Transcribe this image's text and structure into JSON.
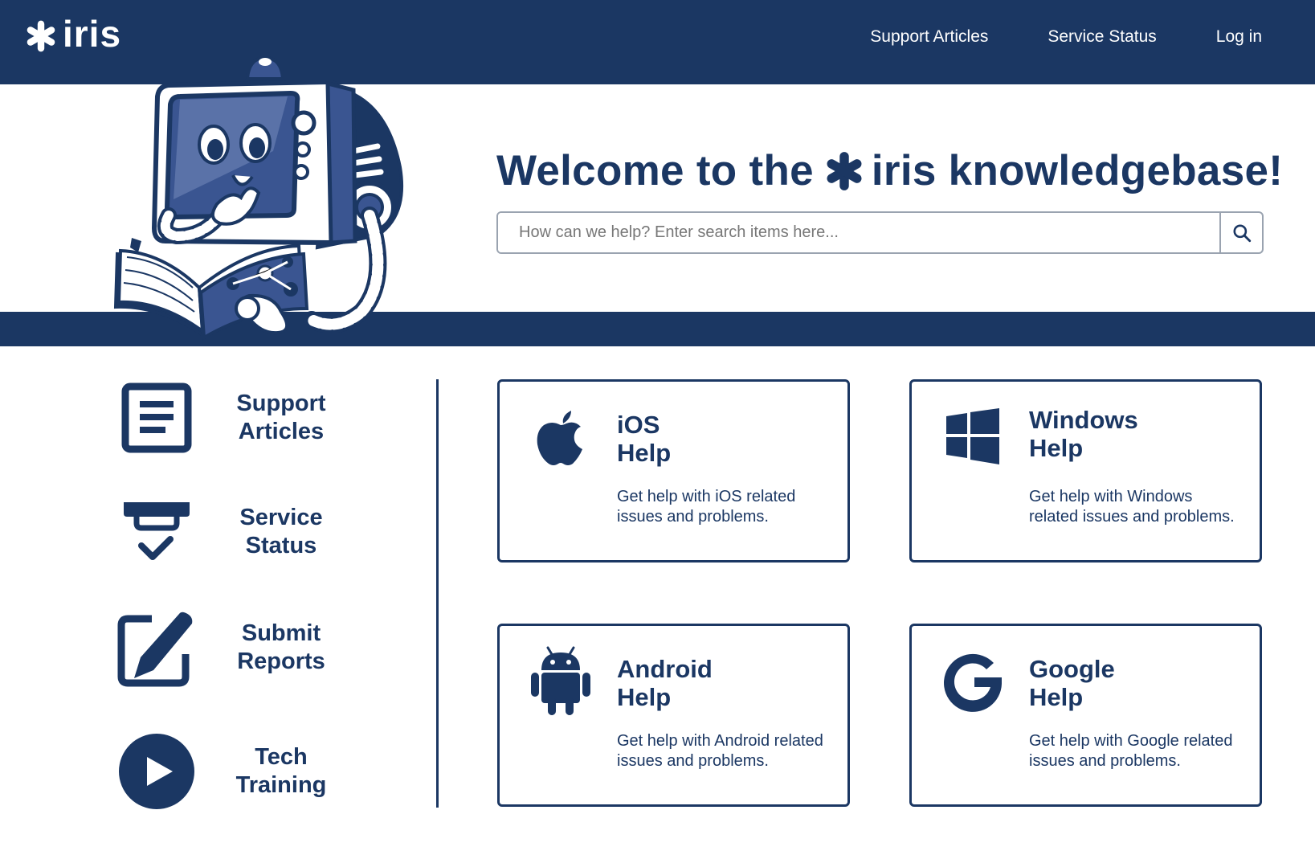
{
  "brand": {
    "name": "iris"
  },
  "header": {
    "nav": [
      {
        "label": "Support Articles"
      },
      {
        "label": "Service Status"
      },
      {
        "label": "Log in"
      }
    ]
  },
  "hero": {
    "welcome_prefix": "Welcome to the",
    "welcome_suffix": "iris knowledgebase!",
    "search_placeholder": "How can we help? Enter search items here..."
  },
  "side_nav": [
    {
      "label_line1": "Support",
      "label_line2": "Articles",
      "icon": "document-icon"
    },
    {
      "label_line1": "Service",
      "label_line2": "Status",
      "icon": "status-check-icon"
    },
    {
      "label_line1": "Submit",
      "label_line2": "Reports",
      "icon": "edit-icon"
    },
    {
      "label_line1": "Tech",
      "label_line2": "Training",
      "icon": "play-icon"
    }
  ],
  "cards": [
    {
      "title_line1": "iOS",
      "title_line2": "Help",
      "description": "Get help with iOS related issues and problems.",
      "icon": "apple-icon"
    },
    {
      "title_line1": "Windows",
      "title_line2": "Help",
      "description": "Get help with Windows related issues and problems.",
      "icon": "windows-icon"
    },
    {
      "title_line1": "Android",
      "title_line2": "Help",
      "description": "Get help with Android related issues and problems.",
      "icon": "android-icon"
    },
    {
      "title_line1": "Google",
      "title_line2": "Help",
      "description": "Get help with Google related issues and problems.",
      "icon": "google-icon"
    }
  ],
  "colors": {
    "primary": "#1b3763",
    "background": "#ffffff",
    "border": "#9aa3b0"
  }
}
